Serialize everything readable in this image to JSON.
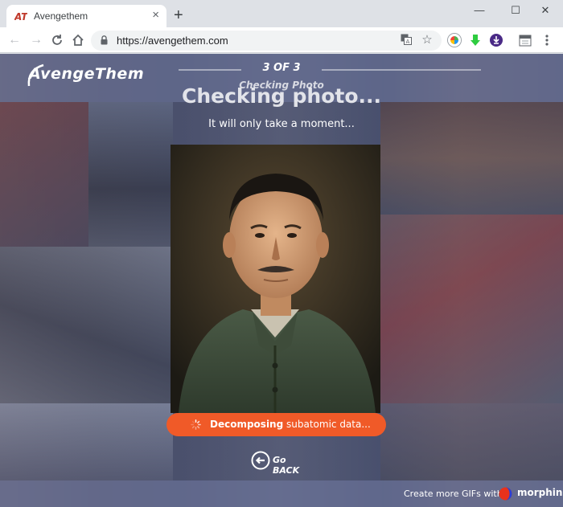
{
  "browser": {
    "tab_title": "Avengethem",
    "tab_close": "×",
    "new_tab": "+",
    "url": "https://avengethem.com",
    "window_controls": {
      "minimize": "—",
      "maximize": "☐",
      "close": "✕"
    },
    "nav": {
      "back": "←",
      "forward": "→",
      "reload": "C",
      "home": "⌂"
    },
    "omnibox_icons": [
      "translate-icon",
      "bookmark-star-icon"
    ],
    "extensions": [
      "compass-icon",
      "download-arrow-icon",
      "downloader-icon",
      "calendar-icon",
      "menu-icon"
    ]
  },
  "header": {
    "logo": "AvengeThem",
    "step_count": "3 OF 3",
    "step_name": "Checking Photo"
  },
  "main": {
    "heading": "Checking photo...",
    "subheading": "It will only take a moment...",
    "status_bold": "Decomposing",
    "status_rest": " subatomic data...",
    "go_back": "Go BACK"
  },
  "footer": {
    "create_more": "Create more GIFs with:",
    "brand": "morphin"
  },
  "colors": {
    "accent_orange": "#f05a28",
    "header_overlay": "#7078a0"
  }
}
